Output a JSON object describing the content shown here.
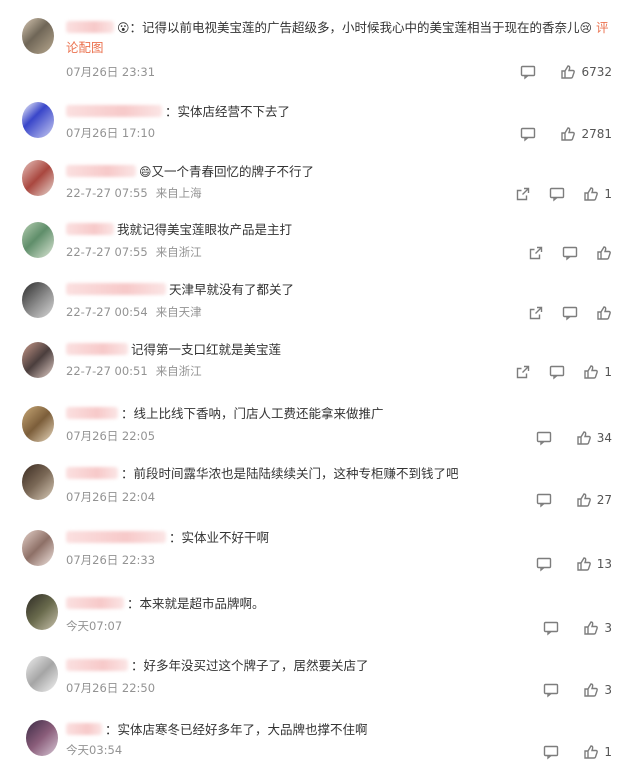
{
  "comments": [
    {
      "text": "记得以前电视美宝莲的广告超级多，小时候我心中的美宝莲相当于现在的香奈儿",
      "reaction_emoji": "😢",
      "prefix_emoji": "😮",
      "link": "评论配图",
      "date": "07月26日 23:31",
      "location": "",
      "likes": "6732",
      "share": false
    },
    {
      "text": "实体店经营不下去了",
      "date": "07月26日 17:10",
      "location": "",
      "likes": "2781",
      "share": false
    },
    {
      "prefix_emoji": "😄",
      "text": "又一个青春回忆的牌子不行了",
      "date": "22-7-27 07:55",
      "location": "来自上海",
      "likes": "1",
      "share": true
    },
    {
      "text": "我就记得美宝莲眼妆产品是主打",
      "date": "22-7-27 07:55",
      "location": "来自浙江",
      "likes": "",
      "share": true
    },
    {
      "text": "天津早就没有了都关了",
      "date": "22-7-27 00:54",
      "location": "来自天津",
      "likes": "",
      "share": true
    },
    {
      "text": "记得第一支口红就是美宝莲",
      "date": "22-7-27 00:51",
      "location": "来自浙江",
      "likes": "1",
      "share": true
    },
    {
      "text": "线上比线下香呐，门店人工费还能拿来做推广",
      "date": "07月26日 22:05",
      "location": "",
      "likes": "34",
      "share": false
    },
    {
      "text": "前段时间露华浓也是陆陆续续关门，这种专柜赚不到钱了吧",
      "date": "07月26日 22:04",
      "location": "",
      "likes": "27",
      "share": false
    },
    {
      "text": "实体业不好干啊",
      "date": "07月26日 22:33",
      "location": "",
      "likes": "13",
      "share": false
    },
    {
      "text": "本来就是超市品牌啊。",
      "date": "今天07:07",
      "location": "",
      "likes": "3",
      "share": false
    },
    {
      "text": "好多年没买过这个牌子了，居然要关店了",
      "date": "07月26日 22:50",
      "location": "",
      "likes": "3",
      "share": false
    },
    {
      "text": "实体店寒冬已经好多年了，大品牌也撑不住啊",
      "date": "今天03:54",
      "location": "",
      "likes": "1",
      "share": false
    }
  ]
}
